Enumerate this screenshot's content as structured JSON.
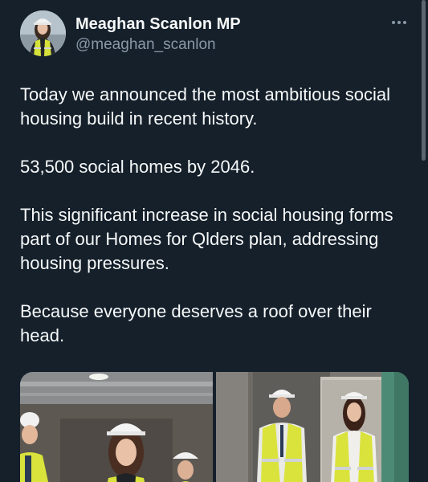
{
  "author": {
    "name": "Meaghan Scanlon MP",
    "handle": "@meaghan_scanlon"
  },
  "tweet": {
    "paragraphs": [
      "Today we announced the most ambitious social\nhousing build in recent history.",
      "53,500 social homes by 2046.",
      "This significant increase in social housing forms\npart of our Homes for Qlders plan, addressing\nhousing pressures.",
      "Because everyone deserves a roof over their\nhead."
    ]
  },
  "media": {
    "photos": [
      {
        "description": "Construction site interior with people in hard hats and hi-vis vests"
      },
      {
        "description": "Two people in white hard hats and yellow hi-vis vests in a building doorway"
      }
    ]
  },
  "icons": {
    "more": "more-horizontal-icon"
  },
  "colors": {
    "background": "#15202b",
    "text_primary": "#f7f9f9",
    "text_secondary": "#8b98a5",
    "hi_vis": "#d6e23a"
  }
}
